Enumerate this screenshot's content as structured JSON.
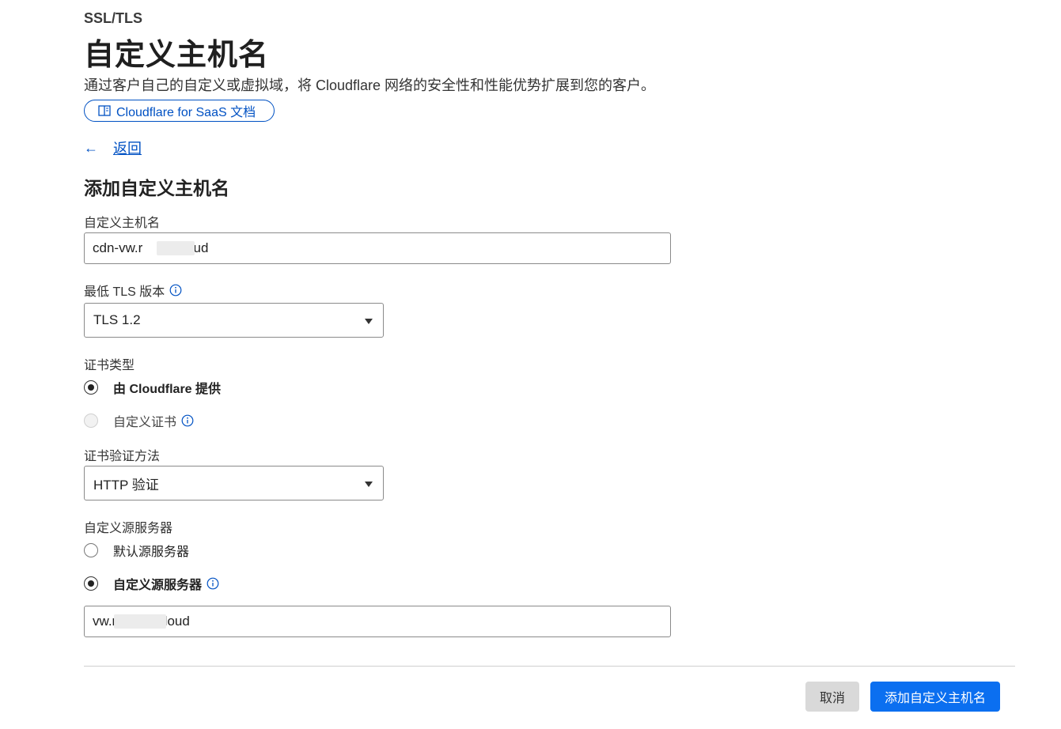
{
  "header": {
    "section": "SSL/TLS",
    "title": "自定义主机名",
    "description": "通过客户自己的自定义或虚拟域，将 Cloudflare 网络的安全性和性能优势扩展到您的客户。",
    "docs_link": "Cloudflare for SaaS 文档"
  },
  "nav": {
    "back_arrow": "←",
    "back_label": "返回"
  },
  "form": {
    "title": "添加自定义主机名",
    "hostname": {
      "label": "自定义主机名",
      "value": "cdn-vw.r        .cloud"
    },
    "min_tls": {
      "label": "最低 TLS 版本",
      "value": "TLS 1.2"
    },
    "cert_type": {
      "label": "证书类型",
      "options": [
        {
          "label": "由 Cloudflare 提供",
          "checked": true
        },
        {
          "label": "自定义证书",
          "checked": false,
          "disabled": true
        }
      ]
    },
    "validation": {
      "label": "证书验证方法",
      "value": "HTTP 验证"
    },
    "origin": {
      "label": "自定义源服务器",
      "options": [
        {
          "label": "默认源服务器",
          "checked": false
        },
        {
          "label": "自定义源服务器",
          "checked": true
        }
      ],
      "value": "vw.r          .cloud"
    }
  },
  "actions": {
    "cancel": "取消",
    "submit": "添加自定义主机名"
  },
  "colors": {
    "accent": "#0051c3",
    "primary_button": "#0b6ff0",
    "secondary_button": "#d9d9d9"
  },
  "icons": [
    "book-icon",
    "back-arrow-icon",
    "info-icon",
    "caret-down-icon"
  ]
}
